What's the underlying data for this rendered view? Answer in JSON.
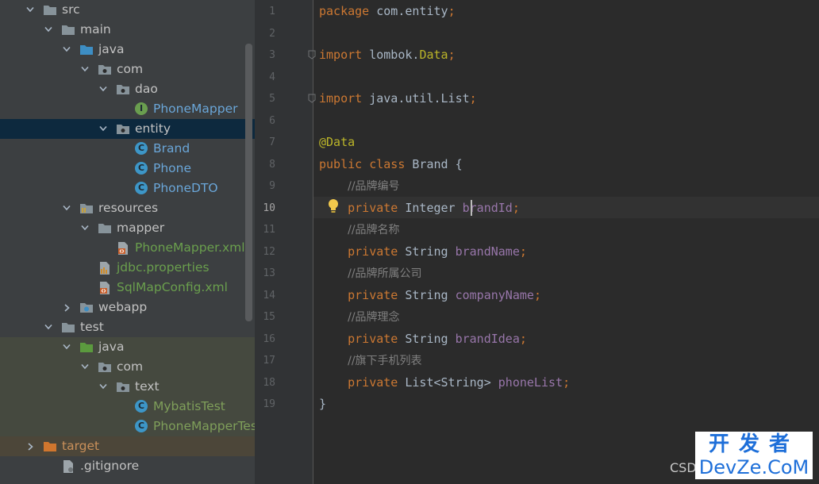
{
  "tree": {
    "rows": [
      {
        "label": "src",
        "expanded": true,
        "kind": "folder",
        "color": "norm"
      },
      {
        "label": "main",
        "expanded": true,
        "kind": "folder",
        "color": "norm"
      },
      {
        "label": "java",
        "expanded": true,
        "kind": "source-folder",
        "color": "norm"
      },
      {
        "label": "com",
        "expanded": true,
        "kind": "package",
        "color": "norm"
      },
      {
        "label": "dao",
        "expanded": true,
        "kind": "package",
        "color": "norm"
      },
      {
        "label": "PhoneMapper",
        "kind": "interface",
        "color": "blue"
      },
      {
        "label": "entity",
        "expanded": true,
        "kind": "package",
        "color": "norm",
        "selected": true
      },
      {
        "label": "Brand",
        "kind": "class",
        "color": "blue"
      },
      {
        "label": "Phone",
        "kind": "class",
        "color": "blue"
      },
      {
        "label": "PhoneDTO",
        "kind": "class",
        "color": "blue"
      },
      {
        "label": "resources",
        "expanded": true,
        "kind": "resources-folder",
        "color": "norm"
      },
      {
        "label": "mapper",
        "expanded": true,
        "kind": "folder",
        "color": "norm"
      },
      {
        "label": "PhoneMapper.xml",
        "kind": "xml",
        "color": "green"
      },
      {
        "label": "jdbc.properties",
        "kind": "properties",
        "color": "green"
      },
      {
        "label": "SqlMapConfig.xml",
        "kind": "xml",
        "color": "green"
      },
      {
        "label": "webapp",
        "expanded": false,
        "kind": "web-folder",
        "color": "norm"
      },
      {
        "label": "test",
        "expanded": true,
        "kind": "folder",
        "color": "norm"
      },
      {
        "label": "java",
        "expanded": true,
        "kind": "test-folder",
        "color": "norm",
        "testbg": true
      },
      {
        "label": "com",
        "expanded": true,
        "kind": "package",
        "color": "norm",
        "testbg": true
      },
      {
        "label": "text",
        "expanded": true,
        "kind": "package",
        "color": "norm",
        "testbg": true
      },
      {
        "label": "MybatisTest",
        "kind": "test-class",
        "color": "lightgreen",
        "testbg": true
      },
      {
        "label": "PhoneMapperTest",
        "kind": "test-class",
        "color": "lightgreen",
        "testbg": true
      },
      {
        "label": "target",
        "expanded": false,
        "kind": "excluded-folder",
        "color": "orange",
        "targetbg": true
      },
      {
        "label": ".gitignore",
        "kind": "file",
        "color": "norm"
      }
    ]
  },
  "editor": {
    "current_line": 10,
    "lines": [
      {
        "n": "1",
        "tokens": [
          [
            "kw",
            "package "
          ],
          [
            "",
            "com.entity"
          ],
          [
            "pn",
            ";"
          ]
        ]
      },
      {
        "n": "2",
        "tokens": []
      },
      {
        "n": "3",
        "tokens": [
          [
            "kw",
            "import "
          ],
          [
            "",
            "lombok."
          ],
          [
            "ann",
            "Data"
          ],
          [
            "pn",
            ";"
          ]
        ]
      },
      {
        "n": "4",
        "tokens": []
      },
      {
        "n": "5",
        "tokens": [
          [
            "kw",
            "import "
          ],
          [
            "",
            "java.util.List"
          ],
          [
            "pn",
            ";"
          ]
        ]
      },
      {
        "n": "6",
        "tokens": []
      },
      {
        "n": "7",
        "tokens": [
          [
            "ann",
            "@Data"
          ]
        ]
      },
      {
        "n": "8",
        "tokens": [
          [
            "kw",
            "public class "
          ],
          [
            "",
            "Brand {"
          ]
        ]
      },
      {
        "n": "9",
        "tokens": [
          [
            "",
            "    "
          ],
          [
            "cmt",
            "//品牌编号"
          ]
        ]
      },
      {
        "n": "10",
        "tokens": [
          [
            "",
            "    "
          ],
          [
            "kw",
            "private "
          ],
          [
            "",
            "Integer "
          ],
          [
            "fld",
            "brandId"
          ],
          [
            "pn",
            ";"
          ]
        ]
      },
      {
        "n": "11",
        "tokens": [
          [
            "",
            "    "
          ],
          [
            "cmt",
            "//品牌名称"
          ]
        ]
      },
      {
        "n": "12",
        "tokens": [
          [
            "",
            "    "
          ],
          [
            "kw",
            "private "
          ],
          [
            "",
            "String "
          ],
          [
            "fld",
            "brandName"
          ],
          [
            "pn",
            ";"
          ]
        ]
      },
      {
        "n": "13",
        "tokens": [
          [
            "",
            "    "
          ],
          [
            "cmt",
            "//品牌所属公司"
          ]
        ]
      },
      {
        "n": "14",
        "tokens": [
          [
            "",
            "    "
          ],
          [
            "kw",
            "private "
          ],
          [
            "",
            "String "
          ],
          [
            "fld",
            "companyName"
          ],
          [
            "pn",
            ";"
          ]
        ]
      },
      {
        "n": "15",
        "tokens": [
          [
            "",
            "    "
          ],
          [
            "cmt",
            "//品牌理念"
          ]
        ]
      },
      {
        "n": "16",
        "tokens": [
          [
            "",
            "    "
          ],
          [
            "kw",
            "private "
          ],
          [
            "",
            "String "
          ],
          [
            "fld",
            "brandIdea"
          ],
          [
            "pn",
            ";"
          ]
        ]
      },
      {
        "n": "17",
        "tokens": [
          [
            "",
            "    "
          ],
          [
            "cmt",
            "//旗下手机列表"
          ]
        ]
      },
      {
        "n": "18",
        "tokens": [
          [
            "",
            "    "
          ],
          [
            "kw",
            "private "
          ],
          [
            "",
            "List<String> "
          ],
          [
            "fld",
            "phoneList"
          ],
          [
            "pn",
            ";"
          ]
        ]
      },
      {
        "n": "19",
        "tokens": [
          [
            "",
            "}"
          ]
        ]
      }
    ]
  },
  "watermark": {
    "csd": "CSD",
    "top": "开发者",
    "bottom": "DevZe.CoM"
  },
  "colors": {
    "keyword": "#cc7832",
    "annotation": "#bbb529",
    "field": "#9876aa",
    "comment": "#808080",
    "text": "#a9b7c6"
  }
}
